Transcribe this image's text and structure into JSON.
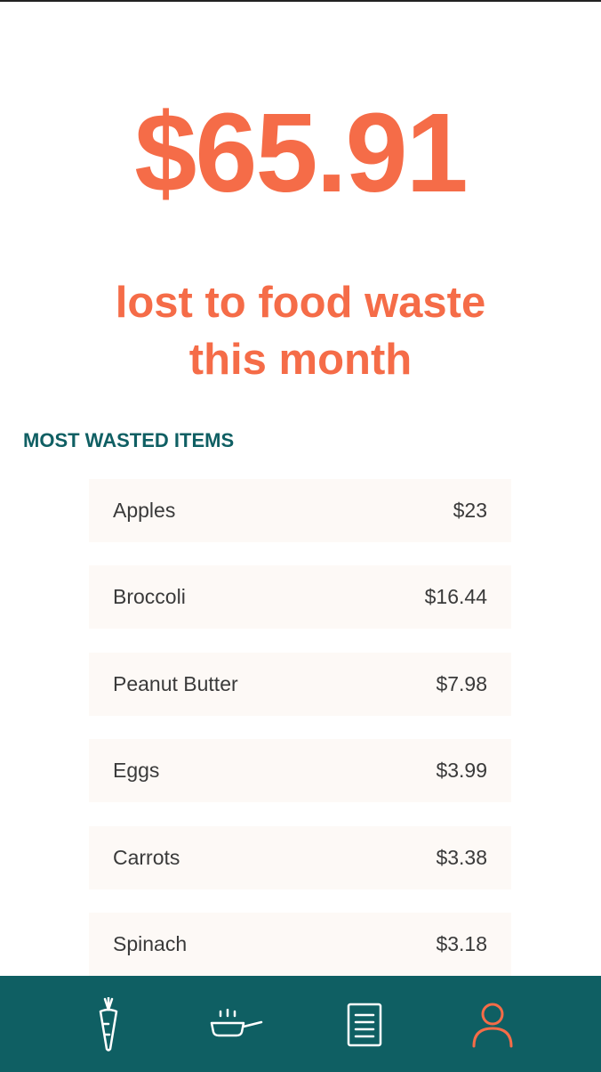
{
  "colors": {
    "accent": "#F56C48",
    "teal": "#0F5F63",
    "row_bg": "#FDF9F6",
    "nav_icon": "#FFFFFF"
  },
  "hero": {
    "amount": "$65.91",
    "caption_line1": "lost to food waste",
    "caption_line2": "this month"
  },
  "section": {
    "title": "MOST WASTED ITEMS"
  },
  "items": [
    {
      "name": "Apples",
      "cost": "$23"
    },
    {
      "name": "Broccoli",
      "cost": "$16.44"
    },
    {
      "name": "Peanut Butter",
      "cost": "$7.98"
    },
    {
      "name": "Eggs",
      "cost": "$3.99"
    },
    {
      "name": "Carrots",
      "cost": "$3.38"
    },
    {
      "name": "Spinach",
      "cost": "$3.18"
    }
  ],
  "nav": {
    "items": [
      {
        "icon": "carrot-icon",
        "active": false
      },
      {
        "icon": "frying-pan-icon",
        "active": false
      },
      {
        "icon": "document-icon",
        "active": false
      },
      {
        "icon": "user-icon",
        "active": true
      }
    ]
  }
}
